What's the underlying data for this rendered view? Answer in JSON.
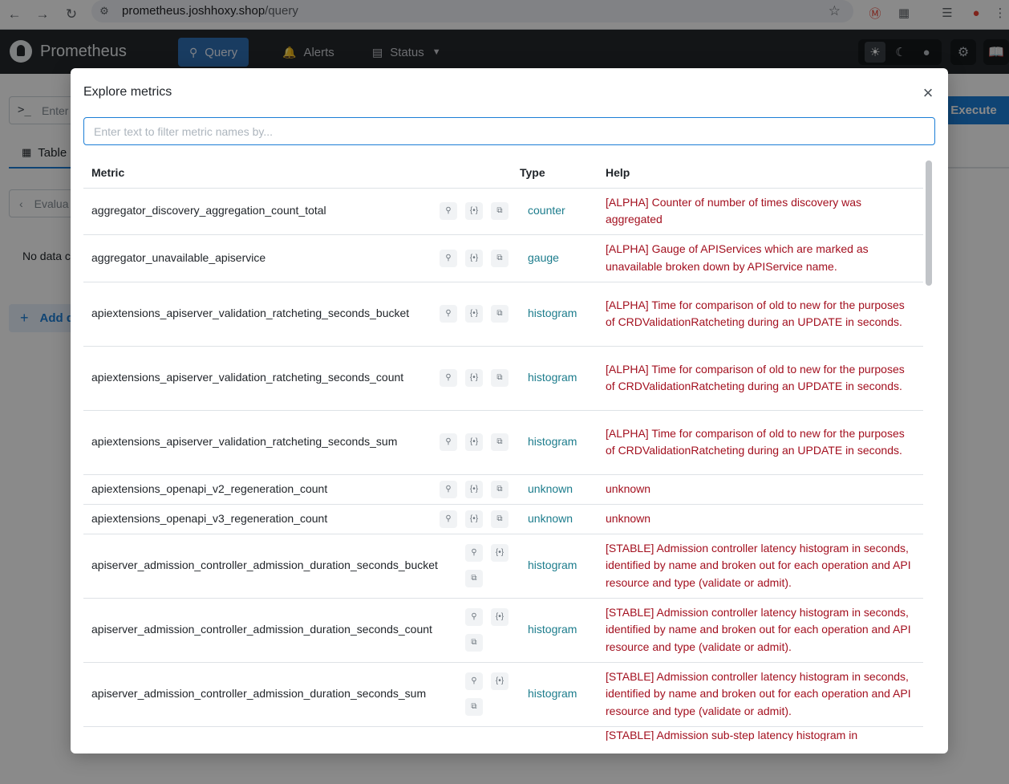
{
  "browser": {
    "url_host": "prometheus.joshhoxy.shop",
    "url_path": "/query"
  },
  "app": {
    "brand": "Prometheus",
    "nav": {
      "query": "Query",
      "alerts": "Alerts",
      "status": "Status"
    },
    "execute_label": "Execute",
    "expression_placeholder": "Enter",
    "tab_table": "Table",
    "eval_label": "Evalua",
    "no_data": "No data c",
    "add_panel": "Add q"
  },
  "modal": {
    "title": "Explore metrics",
    "filter_placeholder": "Enter text to filter metric names by...",
    "columns": {
      "metric": "Metric",
      "type": "Type",
      "help": "Help"
    },
    "rows": [
      {
        "metric": "aggregator_discovery_aggregation_count_total",
        "type": "counter",
        "help": "[ALPHA] Counter of number of times discovery was aggregated"
      },
      {
        "metric": "aggregator_unavailable_apiservice",
        "type": "gauge",
        "help": "[ALPHA] Gauge of APIServices which are marked as unavailable broken down by APIService name."
      },
      {
        "metric": "apiextensions_apiserver_validation_ratcheting_seconds_bucket",
        "type": "histogram",
        "help": "[ALPHA] Time for comparison of old to new for the purposes of CRDValidationRatcheting during an UPDATE in seconds."
      },
      {
        "metric": "apiextensions_apiserver_validation_ratcheting_seconds_count",
        "type": "histogram",
        "help": "[ALPHA] Time for comparison of old to new for the purposes of CRDValidationRatcheting during an UPDATE in seconds."
      },
      {
        "metric": "apiextensions_apiserver_validation_ratcheting_seconds_sum",
        "type": "histogram",
        "help": "[ALPHA] Time for comparison of old to new for the purposes of CRDValidationRatcheting during an UPDATE in seconds."
      },
      {
        "metric": "apiextensions_openapi_v2_regeneration_count",
        "type": "unknown",
        "help": "unknown"
      },
      {
        "metric": "apiextensions_openapi_v3_regeneration_count",
        "type": "unknown",
        "help": "unknown"
      },
      {
        "metric": "apiserver_admission_controller_admission_duration_seconds_bucket",
        "type": "histogram",
        "help": "[STABLE] Admission controller latency histogram in seconds, identified by name and broken out for each operation and API resource and type (validate or admit)."
      },
      {
        "metric": "apiserver_admission_controller_admission_duration_seconds_count",
        "type": "histogram",
        "help": "[STABLE] Admission controller latency histogram in seconds, identified by name and broken out for each operation and API resource and type (validate or admit)."
      },
      {
        "metric": "apiserver_admission_controller_admission_duration_seconds_sum",
        "type": "histogram",
        "help": "[STABLE] Admission controller latency histogram in seconds, identified by name and broken out for each operation and API resource and type (validate or admit)."
      },
      {
        "metric": "",
        "type": "",
        "help": "[STABLE] Admission sub-step latency histogram in"
      }
    ]
  },
  "colors": {
    "accent": "#1c7ed6",
    "type_text": "#1c7c8c",
    "help_text": "#a3101f",
    "header_bg": "#23272b"
  },
  "icons": {
    "row_actions": [
      "zoom-in-icon",
      "brackets-icon",
      "copy-icon"
    ]
  }
}
